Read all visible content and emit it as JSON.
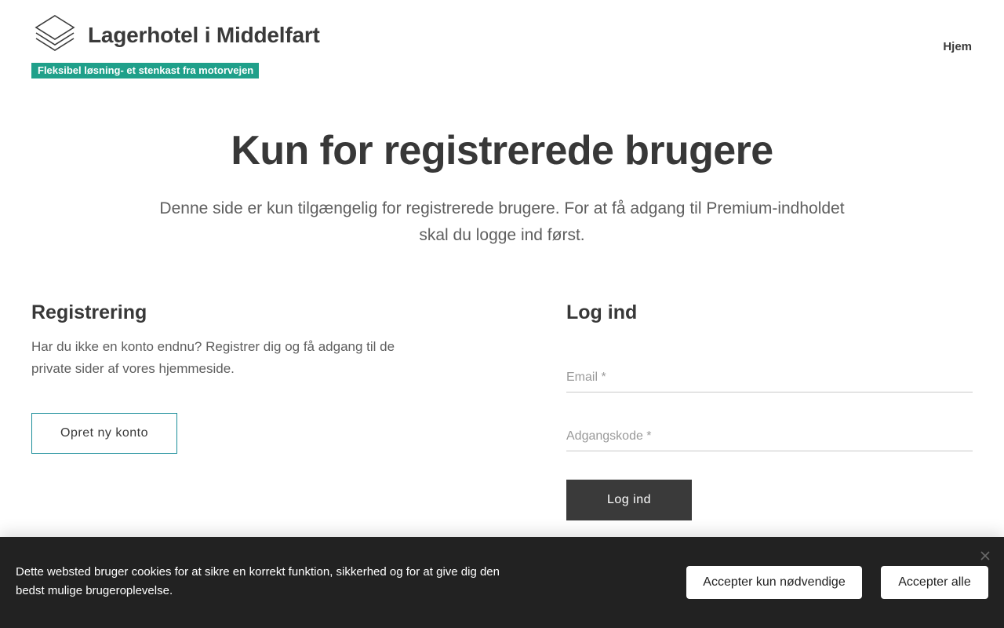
{
  "header": {
    "site_title": "Lagerhotel i Middelfart",
    "tagline": "Fleksibel løsning- et stenkast fra motorvejen",
    "nav": {
      "home_label": "Hjem"
    },
    "logo_icon": "stacked-layers-icon",
    "accent_color": "#1fa08a"
  },
  "main": {
    "title": "Kun for registrerede brugere",
    "intro": "Denne side er kun tilgængelig for registrerede brugere. For at få adgang til Premium-indholdet skal du logge ind først.",
    "registration": {
      "heading": "Registrering",
      "text": "Har du ikke en konto endnu? Registrer dig og få adgang til de private sider af vores hjemmeside.",
      "button_label": "Opret ny konto"
    },
    "login": {
      "heading": "Log ind",
      "email_placeholder": "Email *",
      "email_value": "",
      "password_placeholder": "Adgangskode *",
      "password_value": "",
      "button_label": "Log ind"
    }
  },
  "cookie_bar": {
    "text": "Dette websted bruger cookies for at sikre en korrekt funktion, sikkerhed og for at give dig den bedst mulige brugeroplevelse.",
    "necessary_label": "Accepter kun nødvendige",
    "accept_all_label": "Accepter alle",
    "close_icon": "close-icon",
    "background_color": "#222222"
  }
}
